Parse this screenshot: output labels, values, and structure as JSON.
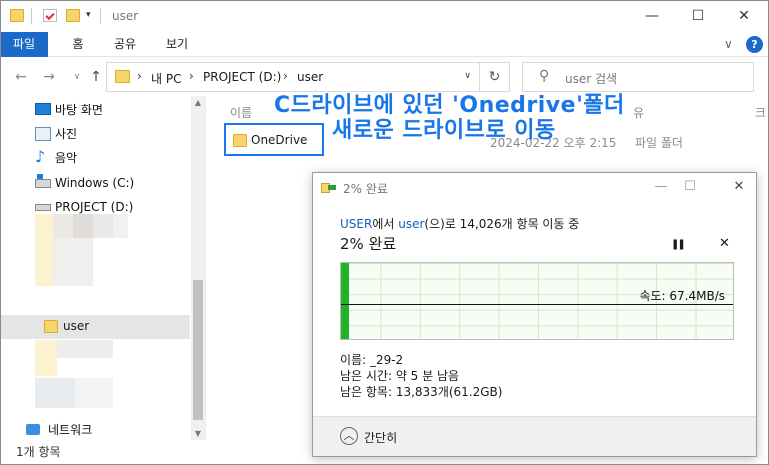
{
  "titlebar": {
    "title": "user",
    "minimize": "—",
    "maximize": "☐",
    "close": "✕"
  },
  "ribbon": {
    "tabs": [
      "파일",
      "홈",
      "공유",
      "보기"
    ],
    "expand": "∨",
    "help": "?"
  },
  "address": {
    "segments": [
      "내 PC",
      "PROJECT (D:)",
      "user"
    ],
    "separator": "›",
    "search_placeholder": "user 검색"
  },
  "sidebar": {
    "items": [
      {
        "label": "바탕 화면",
        "icon": "desktop-icon"
      },
      {
        "label": "사진",
        "icon": "pictures-icon"
      },
      {
        "label": "음악",
        "icon": "music-icon"
      },
      {
        "label": "Windows (C:)",
        "icon": "drive-c-icon"
      },
      {
        "label": "PROJECT (D:)",
        "icon": "drive-d-icon"
      }
    ],
    "selected_folder": "user",
    "network": "네트워크"
  },
  "content": {
    "col_name": "이름",
    "col_type_partial": "유",
    "col_extra_partial": "크",
    "row": {
      "name": "OneDrive",
      "date": "2024-02-22 오후 2:15",
      "type": "파일 폴더"
    }
  },
  "annotation": {
    "line1": "C드라이브에 있던 'Onedrive'폴더",
    "line2": "새로운 드라이브로 이동"
  },
  "status": {
    "count": "1개 항목"
  },
  "dialog": {
    "title": "2% 완료",
    "from": "USER",
    "from_suffix": "에서 ",
    "to": "user",
    "to_suffix": "(으)로 14,026개 항목 이동 중",
    "heading": "2% 완료",
    "pause": "❚❚",
    "cancel": "✕",
    "progress": 0.02,
    "speed": "속도: 67.4MB/s",
    "name_line": "이름: _29-2",
    "time_line": "남은 시간: 약 5 분 남음",
    "items_line": "남은 항목: 13,833개(61.2GB)",
    "less_details": "간단히",
    "colors": {
      "link": "#1a5fb4",
      "fill": "#23b12a"
    }
  }
}
